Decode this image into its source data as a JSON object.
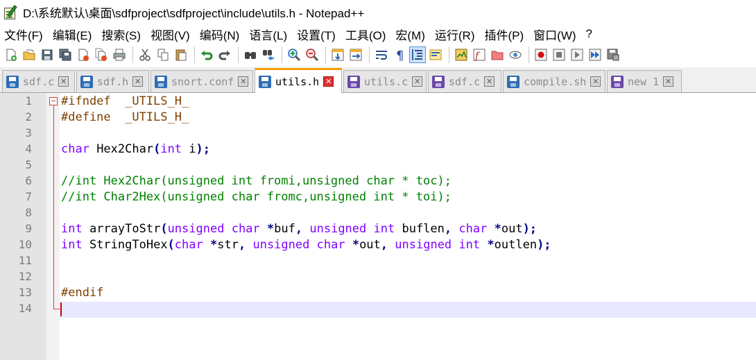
{
  "window": {
    "title": "D:\\系统默认\\桌面\\sdfproject\\sdfproject\\include\\utils.h - Notepad++"
  },
  "menu": [
    {
      "label": "文件(F)"
    },
    {
      "label": "编辑(E)"
    },
    {
      "label": "搜索(S)"
    },
    {
      "label": "视图(V)"
    },
    {
      "label": "编码(N)"
    },
    {
      "label": "语言(L)"
    },
    {
      "label": "设置(T)"
    },
    {
      "label": "工具(O)"
    },
    {
      "label": "宏(M)"
    },
    {
      "label": "运行(R)"
    },
    {
      "label": "插件(P)"
    },
    {
      "label": "窗口(W)"
    },
    {
      "label": "?"
    }
  ],
  "toolbar": {
    "icons": [
      "new-file-icon",
      "open-file-icon",
      "save-icon",
      "save-all-icon",
      "close-icon",
      "close-all-icon",
      "print-icon",
      "cut-icon",
      "copy-icon",
      "paste-icon",
      "undo-icon",
      "redo-icon",
      "find-icon",
      "replace-icon",
      "zoom-in-icon",
      "zoom-out-icon",
      "sync-vertical-icon",
      "sync-horizontal-icon",
      "word-wrap-icon",
      "show-all-chars-icon",
      "indent-guide-icon",
      "udl-icon",
      "doc-map-icon",
      "function-list-icon",
      "folder-workspace-icon",
      "monitor-icon",
      "record-macro-icon",
      "stop-record-icon",
      "play-macro-icon",
      "run-macro-multiple-icon",
      "save-macro-icon"
    ],
    "active_icon": "indent-guide-icon",
    "accent": "#cfe3f8"
  },
  "tabs": [
    {
      "label": "sdf.c",
      "icon": "saved-file-icon",
      "active": false
    },
    {
      "label": "sdf.h",
      "icon": "saved-file-icon",
      "active": false
    },
    {
      "label": "snort.conf",
      "icon": "saved-file-icon",
      "active": false
    },
    {
      "label": "utils.h",
      "icon": "saved-file-icon",
      "active": true
    },
    {
      "label": "utils.c",
      "icon": "unsaved-file-icon",
      "active": false
    },
    {
      "label": "sdf.c",
      "icon": "unsaved-file-icon",
      "active": false
    },
    {
      "label": "compile.sh",
      "icon": "saved-file-icon",
      "active": false
    },
    {
      "label": "new 1",
      "icon": "unsaved-file-icon",
      "active": false
    }
  ],
  "editor": {
    "line_numbers": [
      "1",
      "2",
      "3",
      "4",
      "5",
      "6",
      "7",
      "8",
      "9",
      "10",
      "11",
      "12",
      "13",
      "14"
    ],
    "current_line": "14",
    "colors": {
      "keyword": "#8000ff",
      "comment": "#008000",
      "preprocessor": "#804000",
      "operator": "#000080"
    },
    "lines": [
      [
        {
          "t": "#ifndef  _UTILS_H_",
          "c": "pre"
        }
      ],
      [
        {
          "t": "#define  _UTILS_H_",
          "c": "pre"
        }
      ],
      [],
      [
        {
          "t": "char",
          "c": "kw"
        },
        {
          "t": " Hex2Char",
          "c": "id"
        },
        {
          "t": "(",
          "c": "op"
        },
        {
          "t": "int",
          "c": "kw"
        },
        {
          "t": " i",
          "c": "id"
        },
        {
          "t": ");",
          "c": "op"
        }
      ],
      [],
      [
        {
          "t": "//int Hex2Char(unsigned int fromi,unsigned char * toc);",
          "c": "cm"
        }
      ],
      [
        {
          "t": "//int Char2Hex(unsigned char fromc,unsigned int * toi);",
          "c": "cm"
        }
      ],
      [],
      [
        {
          "t": "int",
          "c": "kw"
        },
        {
          "t": " arrayToStr",
          "c": "id"
        },
        {
          "t": "(",
          "c": "op"
        },
        {
          "t": "unsigned",
          "c": "kw"
        },
        {
          "t": " ",
          "c": "id"
        },
        {
          "t": "char",
          "c": "kw"
        },
        {
          "t": " ",
          "c": "id"
        },
        {
          "t": "*",
          "c": "op"
        },
        {
          "t": "buf",
          "c": "id"
        },
        {
          "t": ",",
          "c": "op"
        },
        {
          "t": " ",
          "c": "id"
        },
        {
          "t": "unsigned",
          "c": "kw"
        },
        {
          "t": " ",
          "c": "id"
        },
        {
          "t": "int",
          "c": "kw"
        },
        {
          "t": " buflen",
          "c": "id"
        },
        {
          "t": ",",
          "c": "op"
        },
        {
          "t": " ",
          "c": "id"
        },
        {
          "t": "char",
          "c": "kw"
        },
        {
          "t": " ",
          "c": "id"
        },
        {
          "t": "*",
          "c": "op"
        },
        {
          "t": "out",
          "c": "id"
        },
        {
          "t": ");",
          "c": "op"
        }
      ],
      [
        {
          "t": "int",
          "c": "kw"
        },
        {
          "t": " StringToHex",
          "c": "id"
        },
        {
          "t": "(",
          "c": "op"
        },
        {
          "t": "char",
          "c": "kw"
        },
        {
          "t": " ",
          "c": "id"
        },
        {
          "t": "*",
          "c": "op"
        },
        {
          "t": "str",
          "c": "id"
        },
        {
          "t": ",",
          "c": "op"
        },
        {
          "t": " ",
          "c": "id"
        },
        {
          "t": "unsigned",
          "c": "kw"
        },
        {
          "t": " ",
          "c": "id"
        },
        {
          "t": "char",
          "c": "kw"
        },
        {
          "t": " ",
          "c": "id"
        },
        {
          "t": "*",
          "c": "op"
        },
        {
          "t": "out",
          "c": "id"
        },
        {
          "t": ",",
          "c": "op"
        },
        {
          "t": " ",
          "c": "id"
        },
        {
          "t": "unsigned",
          "c": "kw"
        },
        {
          "t": " ",
          "c": "id"
        },
        {
          "t": "int",
          "c": "kw"
        },
        {
          "t": " ",
          "c": "id"
        },
        {
          "t": "*",
          "c": "op"
        },
        {
          "t": "outlen",
          "c": "id"
        },
        {
          "t": ");",
          "c": "op"
        }
      ],
      [],
      [],
      [
        {
          "t": "#endif",
          "c": "pre"
        }
      ],
      []
    ]
  }
}
